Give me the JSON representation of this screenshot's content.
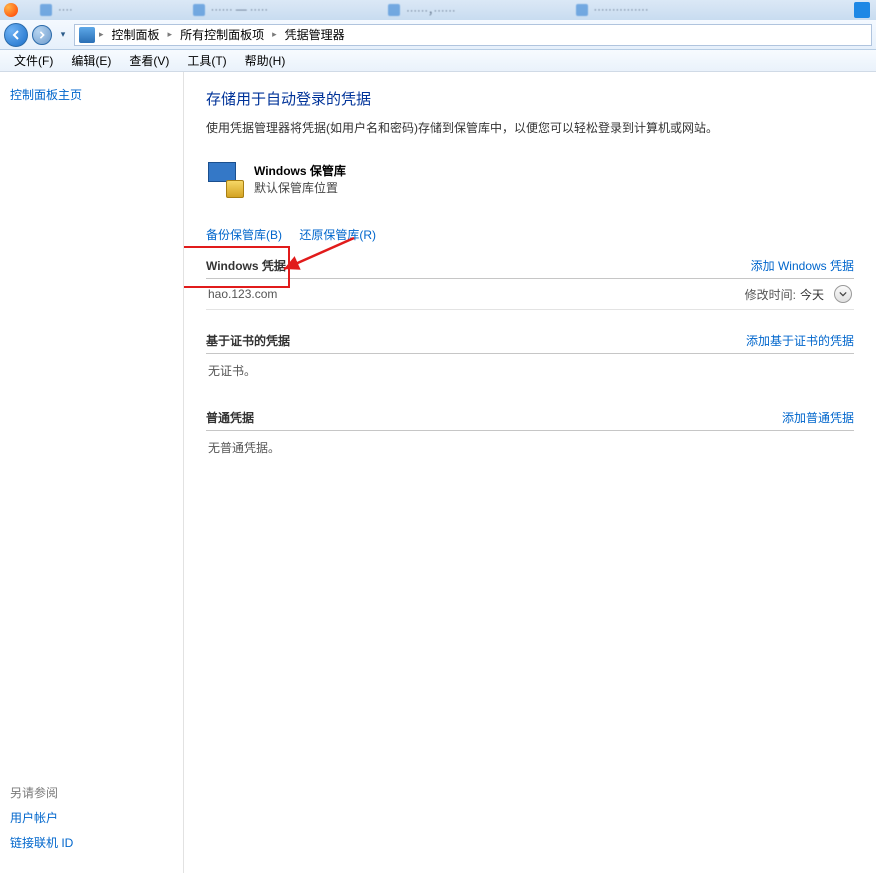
{
  "tabs": [
    {
      "label": "····"
    },
    {
      "label": "······ — ·····"
    },
    {
      "label": "······，······"
    },
    {
      "label": "···············"
    }
  ],
  "breadcrumb": {
    "items": [
      "控制面板",
      "所有控制面板项",
      "凭据管理器"
    ]
  },
  "menu": {
    "file": "文件(F)",
    "edit": "编辑(E)",
    "view": "查看(V)",
    "tools": "工具(T)",
    "help": "帮助(H)"
  },
  "sidebar": {
    "home": "控制面板主页",
    "see_also": "另请参阅",
    "link1": "用户帐户",
    "link2": "链接联机 ID"
  },
  "page": {
    "title": "存储用于自动登录的凭据",
    "desc": "使用凭据管理器将凭据(如用户名和密码)存储到保管库中，以便您可以轻松登录到计算机或网站。"
  },
  "vault": {
    "title": "Windows 保管库",
    "sub": "默认保管库位置"
  },
  "actions": {
    "backup": "备份保管库(B)",
    "restore": "还原保管库(R)"
  },
  "sections": {
    "windows": {
      "title": "Windows 凭据",
      "add": "添加 Windows 凭据",
      "cred1_name": "hao.123.com",
      "cred1_date_label": "修改时间:",
      "cred1_date": "今天"
    },
    "cert": {
      "title": "基于证书的凭据",
      "add": "添加基于证书的凭据",
      "empty": "无证书。"
    },
    "generic": {
      "title": "普通凭据",
      "add": "添加普通凭据",
      "empty": "无普通凭据。"
    }
  }
}
